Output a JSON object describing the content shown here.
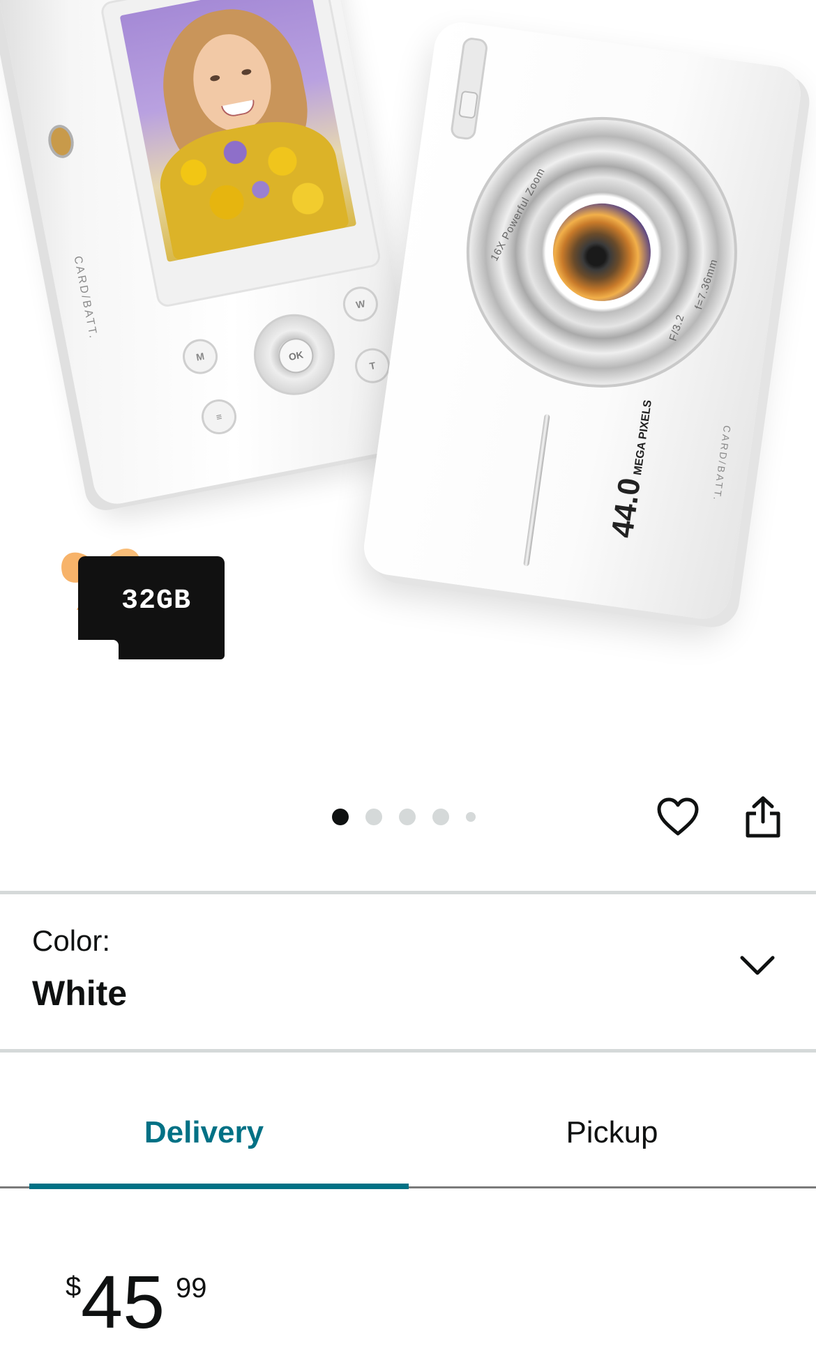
{
  "product_images": {
    "back_camera": {
      "side_label": "CARD/BATT.",
      "buttons": [
        "M",
        "W",
        "T",
        "OK",
        "≡"
      ]
    },
    "front_camera": {
      "lens_text": "16X Powerful Zoom",
      "aperture": "F/3.2",
      "focal": "f=7.36mm",
      "megapixels": "44.0",
      "mp_label": "MEGA PIXELS",
      "side_label": "CARD/BATT."
    },
    "sd_card": {
      "capacity": "32GB"
    }
  },
  "carousel": {
    "count": 5,
    "active_index": 0
  },
  "color_selector": {
    "label": "Color:",
    "value": "White"
  },
  "tabs": {
    "delivery": "Delivery",
    "pickup": "Pickup",
    "active": "delivery"
  },
  "price": {
    "symbol": "$",
    "whole": "45",
    "fraction": "99"
  },
  "colors": {
    "accent": "#007185",
    "text": "#0f1111",
    "divider": "#d5d9d9"
  },
  "icons": {
    "wishlist": "heart-icon",
    "share": "share-icon",
    "dropdown": "chevron-down-icon"
  }
}
